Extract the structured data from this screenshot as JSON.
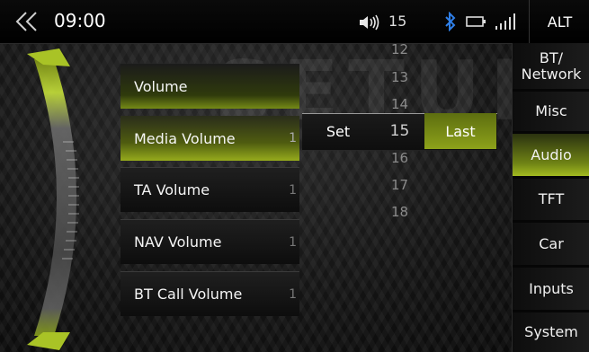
{
  "status_bar": {
    "time": "09:00",
    "volume": "15",
    "alt_label": "ALT"
  },
  "watermark": "SETUP",
  "list": {
    "header": "Volume",
    "items": [
      {
        "label": "Media Volume",
        "value": "1"
      },
      {
        "label": "TA Volume",
        "value": "1"
      },
      {
        "label": "NAV Volume",
        "value": "1"
      },
      {
        "label": "BT Call Volume",
        "value": "1"
      }
    ]
  },
  "picker": {
    "numbers": [
      "12",
      "13",
      "14",
      "15",
      "16",
      "17",
      "18"
    ],
    "selected": "15",
    "set_label": "Set",
    "last_label": "Last"
  },
  "tabs": [
    {
      "label": "BT/\nNetwork",
      "line1": "BT/",
      "line2": "Network"
    },
    {
      "label": "Misc"
    },
    {
      "label": "Audio",
      "active": true
    },
    {
      "label": "TFT"
    },
    {
      "label": "Car"
    },
    {
      "label": "Inputs"
    },
    {
      "label": "System"
    }
  ],
  "colors": {
    "accent_green": "#96ab1c",
    "background": "#0b0b0b",
    "bluetooth_blue": "#2f7fe8"
  },
  "icons": [
    "back-chevrons-icon",
    "speaker-icon",
    "bluetooth-icon",
    "battery-icon",
    "signal-icon"
  ]
}
